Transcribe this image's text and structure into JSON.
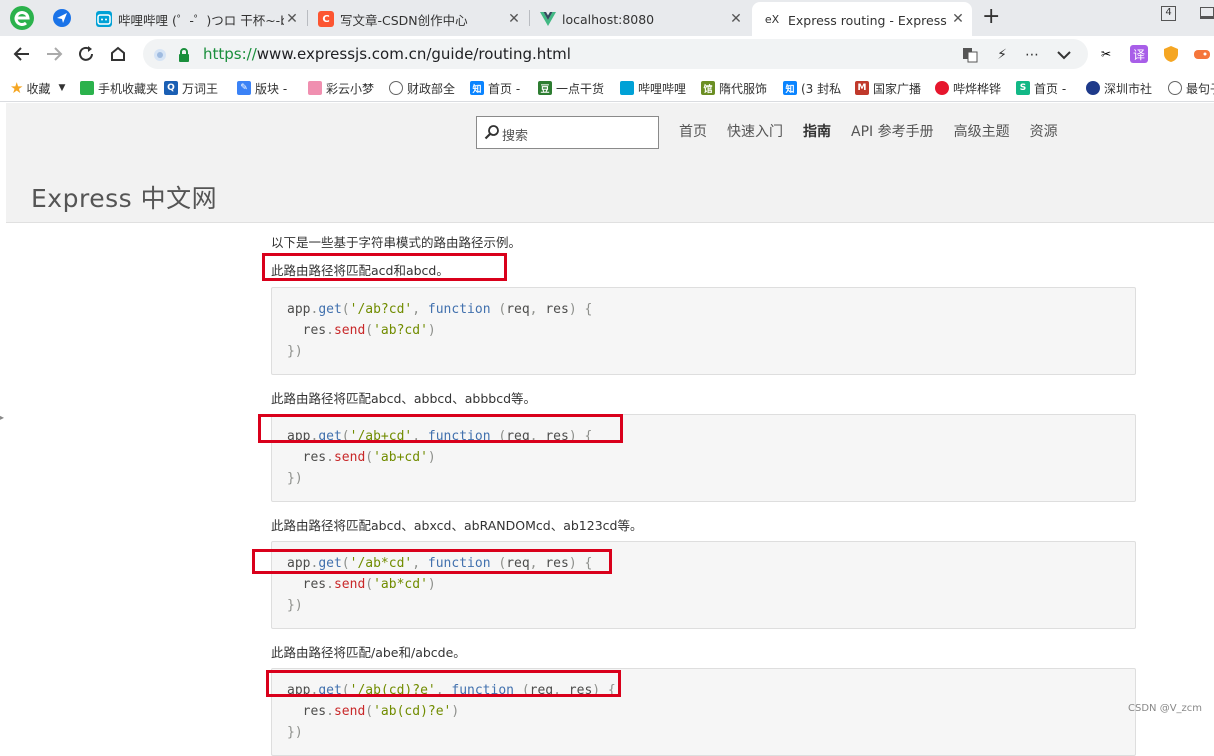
{
  "browser": {
    "tabs": [
      {
        "title": "哔哩哔哩 (゜-゜)つロ 干杯~-b",
        "favicon": "bilibili-icon"
      },
      {
        "title": "写文章-CSDN创作中心",
        "favicon": "csdn-icon"
      },
      {
        "title": "localhost:8080",
        "favicon": "vue-icon"
      },
      {
        "title": "Express routing - Express 中",
        "favicon": "express-icon",
        "active": true
      }
    ],
    "tab_count": "4",
    "url_scheme": "https://",
    "url_rest": "www.expressjs.com.cn/guide/routing.html",
    "bookmarks": [
      "收藏",
      "手机收藏夹",
      "万词王",
      "版块 -",
      "彩云小梦",
      "财政部全",
      "首页 -",
      "一点干货",
      "哔哩哔哩",
      "隋代服饰",
      "(3 封私",
      "国家广播",
      "哔烨桦铧",
      "首页 -",
      "深圳市社",
      "最句子"
    ]
  },
  "site": {
    "search_placeholder": "搜索",
    "nav": [
      "首页",
      "快速入门",
      "指南",
      "API 参考手册",
      "高级主题",
      "资源"
    ],
    "active_nav": "指南",
    "logo": "Express 中文网"
  },
  "content": {
    "intro": "以下是一些基于字符串模式的路由路径示例。",
    "examples": [
      {
        "description": "此路由路径将匹配acd和abcd。",
        "path": "'/ab?cd'",
        "send": "'ab?cd'"
      },
      {
        "description": "此路由路径将匹配abcd、abbcd、abbbcd等。",
        "path": "'/ab+cd'",
        "send": "'ab+cd'"
      },
      {
        "description": "此路由路径将匹配abcd、abxcd、abRANDOMcd、ab123cd等。",
        "path": "'/ab*cd'",
        "send": "'ab*cd'"
      },
      {
        "description": "此路由路径将匹配/abe和/abcde。",
        "path": "'/ab(cd)?e'",
        "send": "'ab(cd)?e'"
      }
    ],
    "code_tokens": {
      "obj": "app",
      "method": "get",
      "keyword": "function",
      "param1": "req",
      "param2": "res",
      "send": "send",
      "close": "})"
    }
  },
  "watermark": "CSDN @V_zcm",
  "colors": {
    "highlight_box": "#d9001b",
    "url_secure": "#1a8f3c",
    "code_keyword": "#4271ae",
    "code_string": "#718c00",
    "code_call": "#c82829"
  }
}
